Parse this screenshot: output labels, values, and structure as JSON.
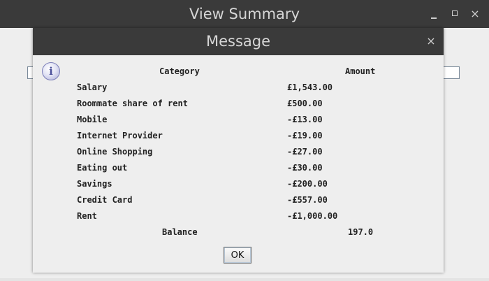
{
  "parent_window": {
    "title": "View Summary",
    "controls": {
      "minimize": "minimize-icon",
      "maximize": "maximize-icon",
      "close": "×"
    }
  },
  "dialog": {
    "title": "Message",
    "close_label": "×",
    "icon": "info-icon",
    "icon_glyph": "i",
    "table": {
      "headers": {
        "category": "Category",
        "amount": "Amount"
      },
      "rows": [
        {
          "category": "Salary",
          "amount": "£1,543.00"
        },
        {
          "category": "Roommate share of rent",
          "amount": "£500.00"
        },
        {
          "category": "Mobile",
          "amount": "-£13.00"
        },
        {
          "category": "Internet Provider",
          "amount": "-£19.00"
        },
        {
          "category": "Online Shopping",
          "amount": "-£27.00"
        },
        {
          "category": "Eating out",
          "amount": "-£30.00"
        },
        {
          "category": "Savings",
          "amount": "-£200.00"
        },
        {
          "category": "Credit Card",
          "amount": "-£557.00"
        },
        {
          "category": "Rent",
          "amount": "-£1,000.00"
        }
      ],
      "balance_label": "Balance",
      "balance_value": "197.0"
    },
    "ok_label": "OK"
  }
}
